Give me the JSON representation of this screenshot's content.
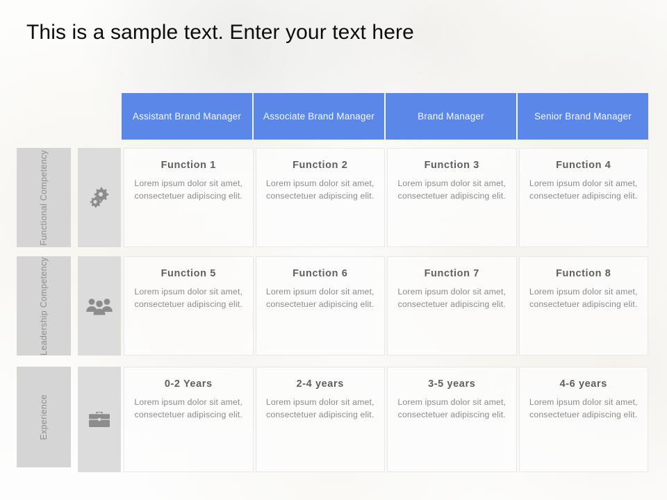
{
  "slide": {
    "title": "This is a sample text. Enter your text here",
    "accent_color": "#5b88e8",
    "label_gray": "#d5d5d5",
    "icon_gray": "#dcdcdc"
  },
  "columns": [
    {
      "label": "Assistant Brand Manager"
    },
    {
      "label": "Associate Brand Manager"
    },
    {
      "label": "Brand Manager"
    },
    {
      "label": "Senior Brand Manager"
    }
  ],
  "rows": [
    {
      "label": "Functional Competency",
      "icon": "gears-icon",
      "cells": [
        {
          "title": "Function 1",
          "body": "Lorem ipsum dolor sit amet, consectetuer adipiscing elit."
        },
        {
          "title": "Function 2",
          "body": "Lorem ipsum dolor sit amet, consectetuer adipiscing elit."
        },
        {
          "title": "Function 3",
          "body": "Lorem ipsum dolor sit amet, consectetuer adipiscing elit."
        },
        {
          "title": "Function 4",
          "body": "Lorem ipsum dolor sit amet, consectetuer adipiscing elit."
        }
      ]
    },
    {
      "label": "Leadership Competency",
      "icon": "people-group-icon",
      "cells": [
        {
          "title": "Function 5",
          "body": "Lorem ipsum dolor sit amet, consectetuer adipiscing elit."
        },
        {
          "title": "Function 6",
          "body": "Lorem ipsum dolor sit amet, consectetuer adipiscing elit."
        },
        {
          "title": "Function 7",
          "body": "Lorem ipsum dolor sit amet, consectetuer adipiscing elit."
        },
        {
          "title": "Function 8",
          "body": "Lorem ipsum dolor sit amet, consectetuer adipiscing elit."
        }
      ]
    },
    {
      "label": "Experience",
      "icon": "briefcase-icon",
      "cells": [
        {
          "title": "0-2 Years",
          "body": "Lorem ipsum dolor sit amet, consectetuer adipiscing elit."
        },
        {
          "title": "2-4 years",
          "body": "Lorem ipsum dolor sit amet, consectetuer adipiscing elit."
        },
        {
          "title": "3-5 years",
          "body": "Lorem ipsum dolor sit amet, consectetuer adipiscing elit."
        },
        {
          "title": "4-6 years",
          "body": "Lorem ipsum dolor sit amet, consectetuer adipiscing elit."
        }
      ]
    }
  ]
}
